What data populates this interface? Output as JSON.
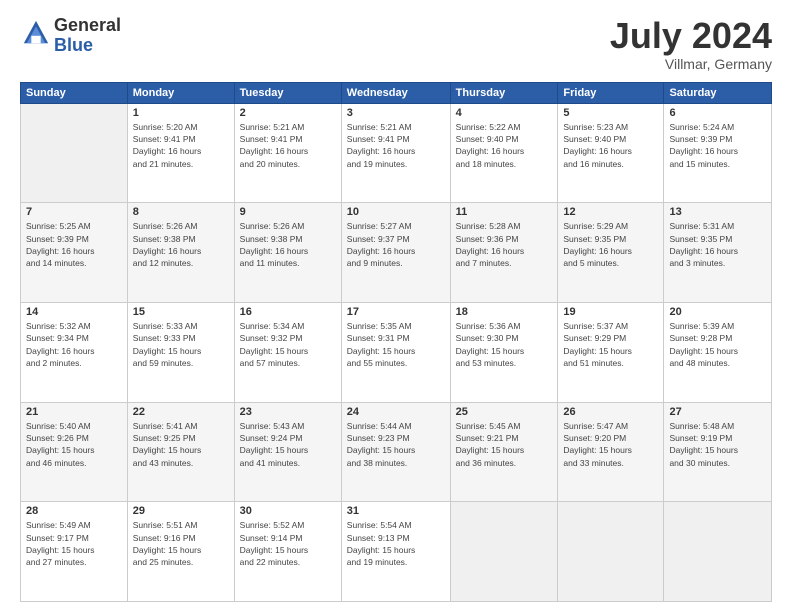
{
  "logo": {
    "general": "General",
    "blue": "Blue"
  },
  "header": {
    "month": "July 2024",
    "location": "Villmar, Germany"
  },
  "weekdays": [
    "Sunday",
    "Monday",
    "Tuesday",
    "Wednesday",
    "Thursday",
    "Friday",
    "Saturday"
  ],
  "weeks": [
    [
      {
        "day": "",
        "info": ""
      },
      {
        "day": "1",
        "info": "Sunrise: 5:20 AM\nSunset: 9:41 PM\nDaylight: 16 hours\nand 21 minutes."
      },
      {
        "day": "2",
        "info": "Sunrise: 5:21 AM\nSunset: 9:41 PM\nDaylight: 16 hours\nand 20 minutes."
      },
      {
        "day": "3",
        "info": "Sunrise: 5:21 AM\nSunset: 9:41 PM\nDaylight: 16 hours\nand 19 minutes."
      },
      {
        "day": "4",
        "info": "Sunrise: 5:22 AM\nSunset: 9:40 PM\nDaylight: 16 hours\nand 18 minutes."
      },
      {
        "day": "5",
        "info": "Sunrise: 5:23 AM\nSunset: 9:40 PM\nDaylight: 16 hours\nand 16 minutes."
      },
      {
        "day": "6",
        "info": "Sunrise: 5:24 AM\nSunset: 9:39 PM\nDaylight: 16 hours\nand 15 minutes."
      }
    ],
    [
      {
        "day": "7",
        "info": "Sunrise: 5:25 AM\nSunset: 9:39 PM\nDaylight: 16 hours\nand 14 minutes."
      },
      {
        "day": "8",
        "info": "Sunrise: 5:26 AM\nSunset: 9:38 PM\nDaylight: 16 hours\nand 12 minutes."
      },
      {
        "day": "9",
        "info": "Sunrise: 5:26 AM\nSunset: 9:38 PM\nDaylight: 16 hours\nand 11 minutes."
      },
      {
        "day": "10",
        "info": "Sunrise: 5:27 AM\nSunset: 9:37 PM\nDaylight: 16 hours\nand 9 minutes."
      },
      {
        "day": "11",
        "info": "Sunrise: 5:28 AM\nSunset: 9:36 PM\nDaylight: 16 hours\nand 7 minutes."
      },
      {
        "day": "12",
        "info": "Sunrise: 5:29 AM\nSunset: 9:35 PM\nDaylight: 16 hours\nand 5 minutes."
      },
      {
        "day": "13",
        "info": "Sunrise: 5:31 AM\nSunset: 9:35 PM\nDaylight: 16 hours\nand 3 minutes."
      }
    ],
    [
      {
        "day": "14",
        "info": "Sunrise: 5:32 AM\nSunset: 9:34 PM\nDaylight: 16 hours\nand 2 minutes."
      },
      {
        "day": "15",
        "info": "Sunrise: 5:33 AM\nSunset: 9:33 PM\nDaylight: 15 hours\nand 59 minutes."
      },
      {
        "day": "16",
        "info": "Sunrise: 5:34 AM\nSunset: 9:32 PM\nDaylight: 15 hours\nand 57 minutes."
      },
      {
        "day": "17",
        "info": "Sunrise: 5:35 AM\nSunset: 9:31 PM\nDaylight: 15 hours\nand 55 minutes."
      },
      {
        "day": "18",
        "info": "Sunrise: 5:36 AM\nSunset: 9:30 PM\nDaylight: 15 hours\nand 53 minutes."
      },
      {
        "day": "19",
        "info": "Sunrise: 5:37 AM\nSunset: 9:29 PM\nDaylight: 15 hours\nand 51 minutes."
      },
      {
        "day": "20",
        "info": "Sunrise: 5:39 AM\nSunset: 9:28 PM\nDaylight: 15 hours\nand 48 minutes."
      }
    ],
    [
      {
        "day": "21",
        "info": "Sunrise: 5:40 AM\nSunset: 9:26 PM\nDaylight: 15 hours\nand 46 minutes."
      },
      {
        "day": "22",
        "info": "Sunrise: 5:41 AM\nSunset: 9:25 PM\nDaylight: 15 hours\nand 43 minutes."
      },
      {
        "day": "23",
        "info": "Sunrise: 5:43 AM\nSunset: 9:24 PM\nDaylight: 15 hours\nand 41 minutes."
      },
      {
        "day": "24",
        "info": "Sunrise: 5:44 AM\nSunset: 9:23 PM\nDaylight: 15 hours\nand 38 minutes."
      },
      {
        "day": "25",
        "info": "Sunrise: 5:45 AM\nSunset: 9:21 PM\nDaylight: 15 hours\nand 36 minutes."
      },
      {
        "day": "26",
        "info": "Sunrise: 5:47 AM\nSunset: 9:20 PM\nDaylight: 15 hours\nand 33 minutes."
      },
      {
        "day": "27",
        "info": "Sunrise: 5:48 AM\nSunset: 9:19 PM\nDaylight: 15 hours\nand 30 minutes."
      }
    ],
    [
      {
        "day": "28",
        "info": "Sunrise: 5:49 AM\nSunset: 9:17 PM\nDaylight: 15 hours\nand 27 minutes."
      },
      {
        "day": "29",
        "info": "Sunrise: 5:51 AM\nSunset: 9:16 PM\nDaylight: 15 hours\nand 25 minutes."
      },
      {
        "day": "30",
        "info": "Sunrise: 5:52 AM\nSunset: 9:14 PM\nDaylight: 15 hours\nand 22 minutes."
      },
      {
        "day": "31",
        "info": "Sunrise: 5:54 AM\nSunset: 9:13 PM\nDaylight: 15 hours\nand 19 minutes."
      },
      {
        "day": "",
        "info": ""
      },
      {
        "day": "",
        "info": ""
      },
      {
        "day": "",
        "info": ""
      }
    ]
  ]
}
